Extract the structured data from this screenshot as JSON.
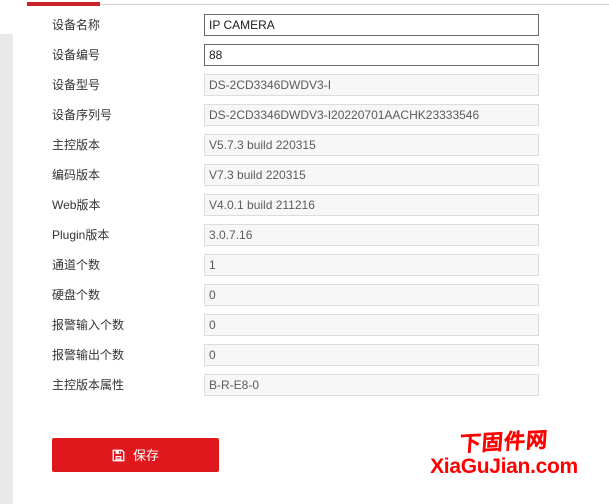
{
  "tabbar": {
    "active_accent_color": "#cc2229",
    "rule_color": "#d2d2d2"
  },
  "form": {
    "rows": [
      {
        "label": "设备名称",
        "value": "IP CAMERA",
        "readonly": false
      },
      {
        "label": "设备编号",
        "value": "88",
        "readonly": false
      },
      {
        "label": "设备型号",
        "value": "DS-2CD3346DWDV3-I",
        "readonly": true
      },
      {
        "label": "设备序列号",
        "value": "DS-2CD3346DWDV3-I20220701AACHK23333546",
        "readonly": true
      },
      {
        "label": "主控版本",
        "value": "V5.7.3 build 220315",
        "readonly": true
      },
      {
        "label": "编码版本",
        "value": "V7.3 build 220315",
        "readonly": true
      },
      {
        "label": "Web版本",
        "value": "V4.0.1 build 211216",
        "readonly": true
      },
      {
        "label": "Plugin版本",
        "value": "3.0.7.16",
        "readonly": true
      },
      {
        "label": "通道个数",
        "value": "1",
        "readonly": true
      },
      {
        "label": "硬盘个数",
        "value": "0",
        "readonly": true
      },
      {
        "label": "报警输入个数",
        "value": "0",
        "readonly": true
      },
      {
        "label": "报警输出个数",
        "value": "0",
        "readonly": true
      },
      {
        "label": "主控版本属性",
        "value": "B-R-E8-0",
        "readonly": true
      }
    ]
  },
  "actions": {
    "save_label": "保存",
    "save_icon": "floppy-disk-icon",
    "save_color": "#e1171e"
  },
  "watermark": {
    "brush_text": "下固件网",
    "domain_text": "XiaGuJian.com",
    "color": "#ff0000"
  }
}
